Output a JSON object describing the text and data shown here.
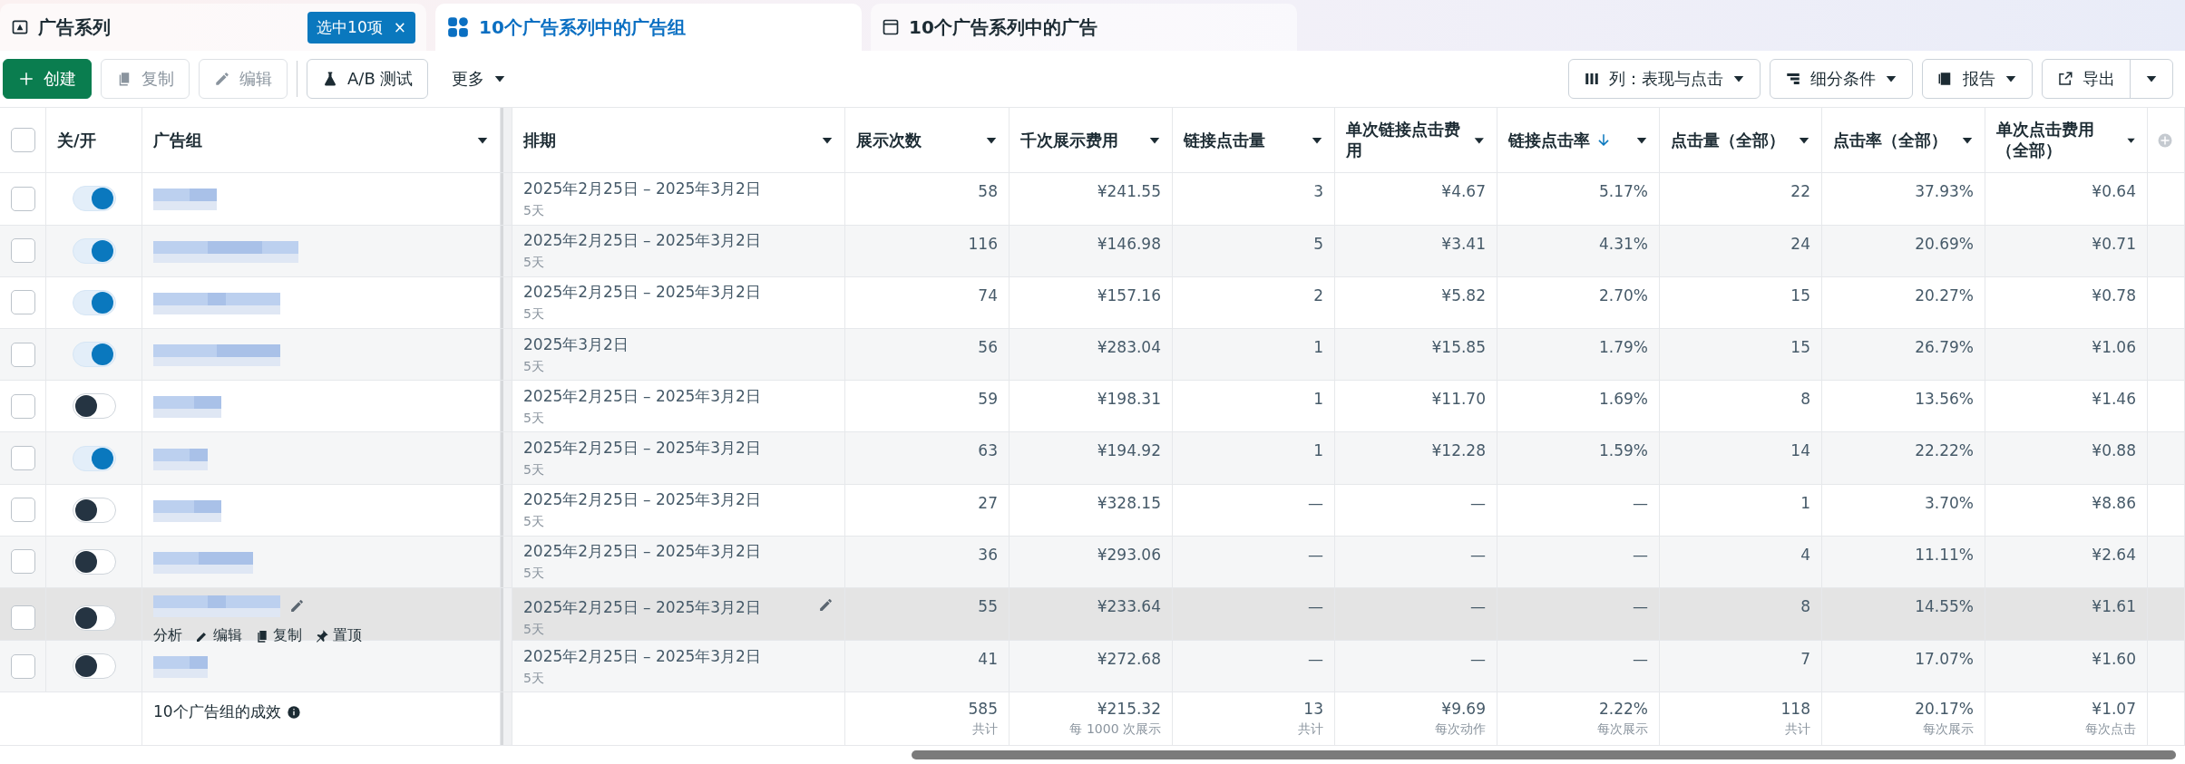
{
  "tabs": [
    {
      "label": "广告系列",
      "selected": false,
      "badge": "选中10项",
      "badge_close": "×"
    },
    {
      "label": "10个广告系列中的广告组",
      "selected": true
    },
    {
      "label": "10个广告系列中的广告",
      "selected": false
    }
  ],
  "toolbar": {
    "left": [
      {
        "label": "创建",
        "kind": "primary",
        "disabled": false
      },
      {
        "label": "复制",
        "kind": "copy",
        "disabled": true
      },
      {
        "label": "编辑",
        "kind": "edit",
        "disabled": true
      },
      {
        "label": "A/B 测试",
        "kind": "test",
        "disabled": false
      },
      {
        "label": "更多",
        "kind": "menu",
        "disabled": false
      }
    ],
    "right": [
      {
        "label": "列：表现与点击",
        "kind": "columns"
      },
      {
        "label": "细分条件",
        "kind": "breakdown"
      },
      {
        "label": "报告",
        "kind": "report"
      },
      {
        "label": "导出",
        "kind": "export"
      }
    ]
  },
  "table": {
    "all_checked": false,
    "columns": [
      {
        "label": "关/开",
        "sorted": false
      },
      {
        "label": "广告组",
        "sorted": false
      },
      {
        "label": "排期",
        "sorted": false
      },
      {
        "label": "展示次数",
        "sorted": false
      },
      {
        "label": "千次展示费用",
        "sorted": false
      },
      {
        "label": "链接点击量",
        "sorted": false
      },
      {
        "label": "单次链接点击费用",
        "sorted": false
      },
      {
        "label": "链接点击率",
        "sorted": true
      },
      {
        "label": "点击量（全部）",
        "sorted": false
      },
      {
        "label": "点击率（全部）",
        "sorted": false
      },
      {
        "label": "单次点击费用（全部）",
        "sorted": false
      }
    ],
    "rows": [
      {
        "checked": false,
        "on": true,
        "hovered": false,
        "schedule": "2025年2月25日 – 2025年3月2日",
        "duration": "5天",
        "cells": [
          "58",
          "¥241.55",
          "3",
          "¥4.67",
          "5.17%",
          "22",
          "37.93%",
          "¥0.64"
        ]
      },
      {
        "checked": false,
        "on": true,
        "hovered": false,
        "schedule": "2025年2月25日 – 2025年3月2日",
        "duration": "5天",
        "cells": [
          "116",
          "¥146.98",
          "5",
          "¥3.41",
          "4.31%",
          "24",
          "20.69%",
          "¥0.71"
        ]
      },
      {
        "checked": false,
        "on": true,
        "hovered": false,
        "schedule": "2025年2月25日 – 2025年3月2日",
        "duration": "5天",
        "cells": [
          "74",
          "¥157.16",
          "2",
          "¥5.82",
          "2.70%",
          "15",
          "20.27%",
          "¥0.78"
        ]
      },
      {
        "checked": false,
        "on": true,
        "hovered": false,
        "schedule": "2025年3月2日",
        "duration": "5天",
        "cells": [
          "56",
          "¥283.04",
          "1",
          "¥15.85",
          "1.79%",
          "15",
          "26.79%",
          "¥1.06"
        ]
      },
      {
        "checked": false,
        "on": false,
        "hovered": false,
        "schedule": "2025年2月25日 – 2025年3月2日",
        "duration": "5天",
        "cells": [
          "59",
          "¥198.31",
          "1",
          "¥11.70",
          "1.69%",
          "8",
          "13.56%",
          "¥1.46"
        ]
      },
      {
        "checked": false,
        "on": true,
        "hovered": false,
        "schedule": "2025年2月25日 – 2025年3月2日",
        "duration": "5天",
        "cells": [
          "63",
          "¥194.92",
          "1",
          "¥12.28",
          "1.59%",
          "14",
          "22.22%",
          "¥0.88"
        ]
      },
      {
        "checked": false,
        "on": false,
        "hovered": false,
        "schedule": "2025年2月25日 – 2025年3月2日",
        "duration": "5天",
        "cells": [
          "27",
          "¥328.15",
          "—",
          "—",
          "—",
          "1",
          "3.70%",
          "¥8.86"
        ]
      },
      {
        "checked": false,
        "on": false,
        "hovered": false,
        "schedule": "2025年2月25日 – 2025年3月2日",
        "duration": "5天",
        "cells": [
          "36",
          "¥293.06",
          "—",
          "—",
          "—",
          "4",
          "11.11%",
          "¥2.64"
        ]
      },
      {
        "checked": false,
        "on": false,
        "hovered": true,
        "schedule": "2025年2月25日 – 2025年3月2日",
        "duration": "5天",
        "cells": [
          "55",
          "¥233.64",
          "—",
          "—",
          "—",
          "8",
          "14.55%",
          "¥1.61"
        ],
        "actions": [
          {
            "label": "分析",
            "kind": "analyze"
          },
          {
            "label": "编辑",
            "kind": "edit"
          },
          {
            "label": "复制",
            "kind": "copy"
          },
          {
            "label": "置顶",
            "kind": "pin"
          }
        ]
      },
      {
        "checked": false,
        "on": false,
        "hovered": false,
        "schedule": "2025年2月25日 – 2025年3月2日",
        "duration": "5天",
        "cells": [
          "41",
          "¥272.68",
          "—",
          "—",
          "—",
          "7",
          "17.07%",
          "¥1.60"
        ]
      }
    ],
    "footer": {
      "label": "10个广告组的成效",
      "totals": [
        {
          "value": "585",
          "note": "共计"
        },
        {
          "value": "¥215.32",
          "note": "每 1000 次展示"
        },
        {
          "value": "13",
          "note": "共计"
        },
        {
          "value": "¥9.69",
          "note": "每次动作"
        },
        {
          "value": "2.22%",
          "note": "每次展示"
        },
        {
          "value": "118",
          "note": "共计"
        },
        {
          "value": "20.17%",
          "note": "每次展示"
        },
        {
          "value": "¥1.07",
          "note": "每次点击"
        }
      ]
    }
  }
}
